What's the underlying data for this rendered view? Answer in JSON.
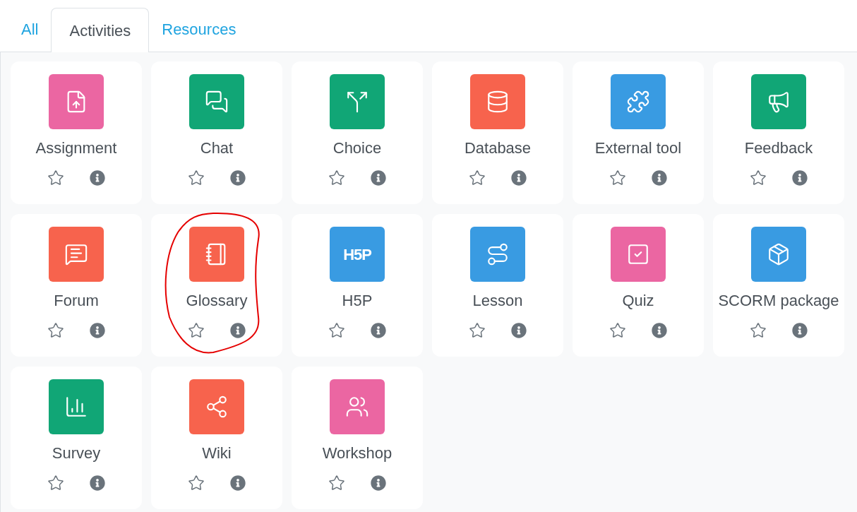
{
  "tabs": [
    {
      "label": "All",
      "selected": false
    },
    {
      "label": "Activities",
      "selected": true
    },
    {
      "label": "Resources",
      "selected": false
    }
  ],
  "modules": [
    {
      "name": "Assignment",
      "color": "#eb66a2",
      "starred": false,
      "circled": false
    },
    {
      "name": "Chat",
      "color": "#11a676",
      "starred": false,
      "circled": false
    },
    {
      "name": "Choice",
      "color": "#11a676",
      "starred": false,
      "circled": false
    },
    {
      "name": "Database",
      "color": "#f7634d",
      "starred": false,
      "circled": false
    },
    {
      "name": "External tool",
      "color": "#399be2",
      "starred": false,
      "circled": false
    },
    {
      "name": "Feedback",
      "color": "#11a676",
      "starred": false,
      "circled": false
    },
    {
      "name": "Forum",
      "color": "#f7634d",
      "starred": false,
      "circled": false
    },
    {
      "name": "Glossary",
      "color": "#f7634d",
      "starred": false,
      "circled": true
    },
    {
      "name": "H5P",
      "logo_text": "H5P",
      "color": "#399be2",
      "starred": false,
      "circled": false
    },
    {
      "name": "Lesson",
      "color": "#399be2",
      "starred": false,
      "circled": false
    },
    {
      "name": "Quiz",
      "color": "#eb66a2",
      "starred": false,
      "circled": false
    },
    {
      "name": "SCORM package",
      "color": "#399be2",
      "starred": false,
      "circled": false
    },
    {
      "name": "Survey",
      "color": "#11a676",
      "starred": false,
      "circled": false
    },
    {
      "name": "Wiki",
      "color": "#f7634d",
      "starred": false,
      "circled": false
    },
    {
      "name": "Workshop",
      "color": "#eb66a2",
      "starred": false,
      "circled": false
    }
  ]
}
